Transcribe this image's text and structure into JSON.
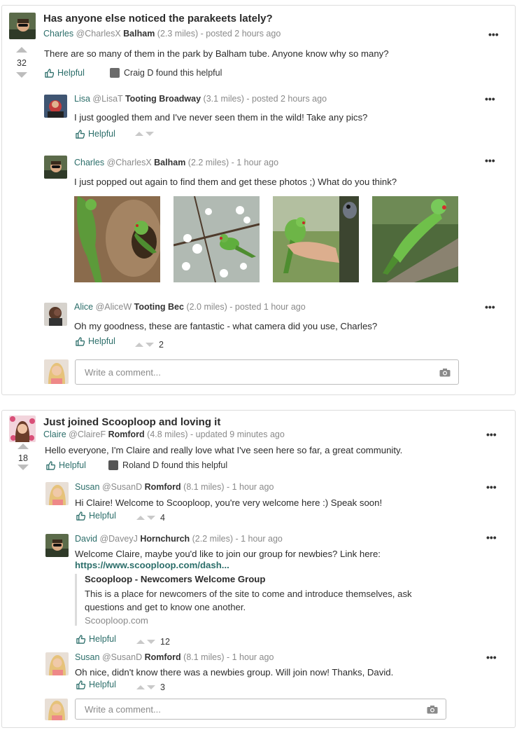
{
  "posts": [
    {
      "title": "Has anyone else noticed the parakeets lately?",
      "author": {
        "name": "Charles",
        "handle": "@CharlesX",
        "area": "Balham",
        "distance": "(2.3 miles)",
        "time": "- posted 2 hours ago"
      },
      "votes": "32",
      "body": "There are so many of them in the park by Balham tube. Anyone know why so many?",
      "helpful_label": "Helpful",
      "found_helpful": "Craig D found this helpful",
      "comments": [
        {
          "name": "Lisa",
          "handle": "@LisaT",
          "area": "Tooting Broadway",
          "distance": "(3.1 miles)",
          "time": "- posted 2 hours ago",
          "text": "I just googled them and I've never seen them in the wild! Take any pics?",
          "helpful_label": "Helpful",
          "votes": ""
        },
        {
          "name": "Charles",
          "handle": "@CharlesX",
          "area": "Balham",
          "distance": "(2.2 miles)",
          "time": "- 1 hour ago",
          "text": "I just popped out again to find them and get these photos ;) What do you think?",
          "photos": [
            "parakeet-tree-photo",
            "parakeet-blossom-photo",
            "parakeet-hand-photo",
            "parakeet-branch-photo"
          ]
        },
        {
          "name": "Alice",
          "handle": "@AliceW",
          "area": "Tooting Bec",
          "distance": "(2.0 miles)",
          "time": "- posted 1 hour ago",
          "text": "Oh my goodness, these are fantastic - what camera did you use, Charles?",
          "helpful_label": "Helpful",
          "votes": "2"
        }
      ],
      "comment_placeholder": "Write a comment..."
    },
    {
      "title": "Just joined Scooploop and loving it",
      "author": {
        "name": "Claire",
        "handle": "@ClaireF",
        "area": "Romford",
        "distance": "(4.8 miles)",
        "time": "- updated 9 minutes ago"
      },
      "votes": "18",
      "body": "Hello everyone, I'm Claire and really love what I've seen here so far, a great community.",
      "helpful_label": "Helpful",
      "found_helpful": "Roland D found this helpful",
      "comments": [
        {
          "name": "Susan",
          "handle": "@SusanD",
          "area": "Romford",
          "distance": "(8.1 miles)",
          "time": "- 1 hour ago",
          "text": "Hi Claire! Welcome to Scooploop, you're very welcome here :) Speak soon!",
          "helpful_label": "Helpful",
          "votes": "4"
        },
        {
          "name": "David",
          "handle": "@DaveyJ",
          "area": "Hornchurch",
          "distance": "(2.2 miles)",
          "time": "- 1 hour ago",
          "text": "Welcome Claire, maybe you'd like to join our group for newbies? Link here:",
          "link": "https://www.scooploop.com/dash...",
          "preview": {
            "title": "Scooploop - Newcomers Welcome Group",
            "desc1": "This is a place for newcomers of the site to come and introduce themselves, ask",
            "desc2": "questions and get to know one another.",
            "site": "Scooploop.com"
          },
          "helpful_label": "Helpful",
          "votes": "12"
        },
        {
          "name": "Susan",
          "handle": "@SusanD",
          "area": "Romford",
          "distance": "(8.1 miles)",
          "time": "- 1 hour ago",
          "text": "Oh nice, didn't know there was a newbies group. Will join now! Thanks, David.",
          "helpful_label": "Helpful",
          "votes": "3"
        }
      ],
      "comment_placeholder": "Write a comment..."
    }
  ],
  "more_icon": "•••",
  "colors": {
    "accent": "#2c6e6a",
    "border": "#dcdcdc",
    "arrow": "#c9c9c9"
  }
}
